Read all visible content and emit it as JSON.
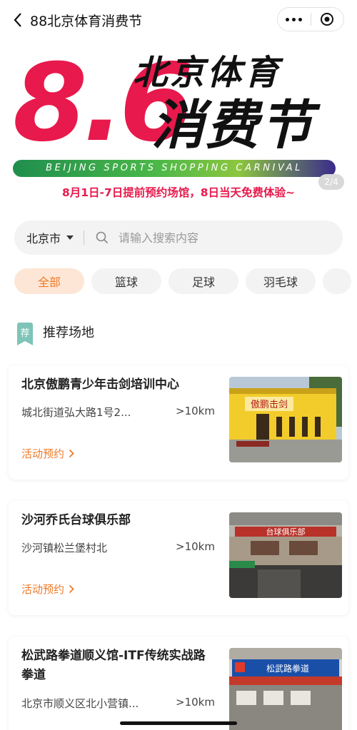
{
  "nav": {
    "title": "88北京体育消费节"
  },
  "banner": {
    "big_number": "8.6",
    "title_line1": "北京体育",
    "title_line2": "消费节",
    "carnival": "BEIJING SPORTS SHOPPING CARNIVAL",
    "promo": "8月1日-7日提前预约场馆，8日当天免费体验~",
    "pager": "2/4"
  },
  "search": {
    "city": "北京市",
    "placeholder": "请输入搜索内容"
  },
  "tabs": [
    {
      "label": "全部",
      "active": true
    },
    {
      "label": "篮球"
    },
    {
      "label": "足球"
    },
    {
      "label": "羽毛球"
    },
    {
      "label": ""
    }
  ],
  "section": {
    "badge": "荐",
    "title": "推荐场地"
  },
  "venues": [
    {
      "name": "北京傲鹏青少年击剑培训中心",
      "address": "城北街道弘大路1号2...",
      "distance": ">10km",
      "action": "活动预约"
    },
    {
      "name": "沙河乔氏台球俱乐部",
      "address": "沙河镇松兰堡村北",
      "distance": ">10km",
      "action": "活动预约"
    },
    {
      "name": "松武路拳道顺义馆-ITF传统实战路拳道",
      "address": "北京市顺义区北小营镇...",
      "distance": ">10km",
      "action": ""
    }
  ],
  "thumbs": {
    "v1_sign": "傲鹏击剑",
    "v2_sign": "台球俱乐部",
    "v3_sign": "松武路拳道"
  },
  "colors": {
    "accent": "#f07a2a",
    "brand_red": "#e8194c",
    "active_tab_bg": "#fde6d6"
  }
}
